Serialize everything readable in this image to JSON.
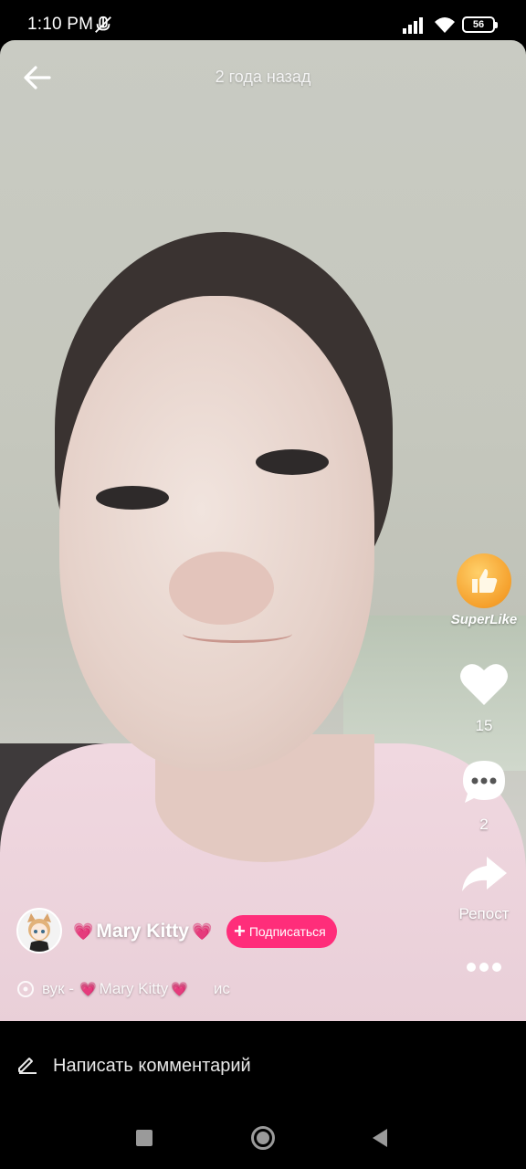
{
  "status_bar": {
    "time": "1:10 PM",
    "battery": "56",
    "icons": [
      "mute-icon",
      "signal-icon",
      "wifi-icon",
      "battery-icon"
    ]
  },
  "header": {
    "back_icon": "back-arrow-icon",
    "time_ago": "2 года назад"
  },
  "actions": {
    "superlike_label": "SuperLike",
    "like_count": "15",
    "comment_count": "2",
    "repost_label": "Репост",
    "more_icon": "more-dots-icon"
  },
  "author": {
    "name": "Mary Kitty",
    "heart": "💗",
    "subscribe_label": "Подписаться"
  },
  "music": {
    "prefix": "вук -",
    "name": "Mary Kitty",
    "suffix": "ис"
  },
  "comment_bar": {
    "placeholder": "Написать комментарий"
  },
  "nav": [
    "recents-button",
    "home-button",
    "back-button"
  ],
  "colors": {
    "accent": "#ff2d7a",
    "superlike": "#f5a02c"
  }
}
